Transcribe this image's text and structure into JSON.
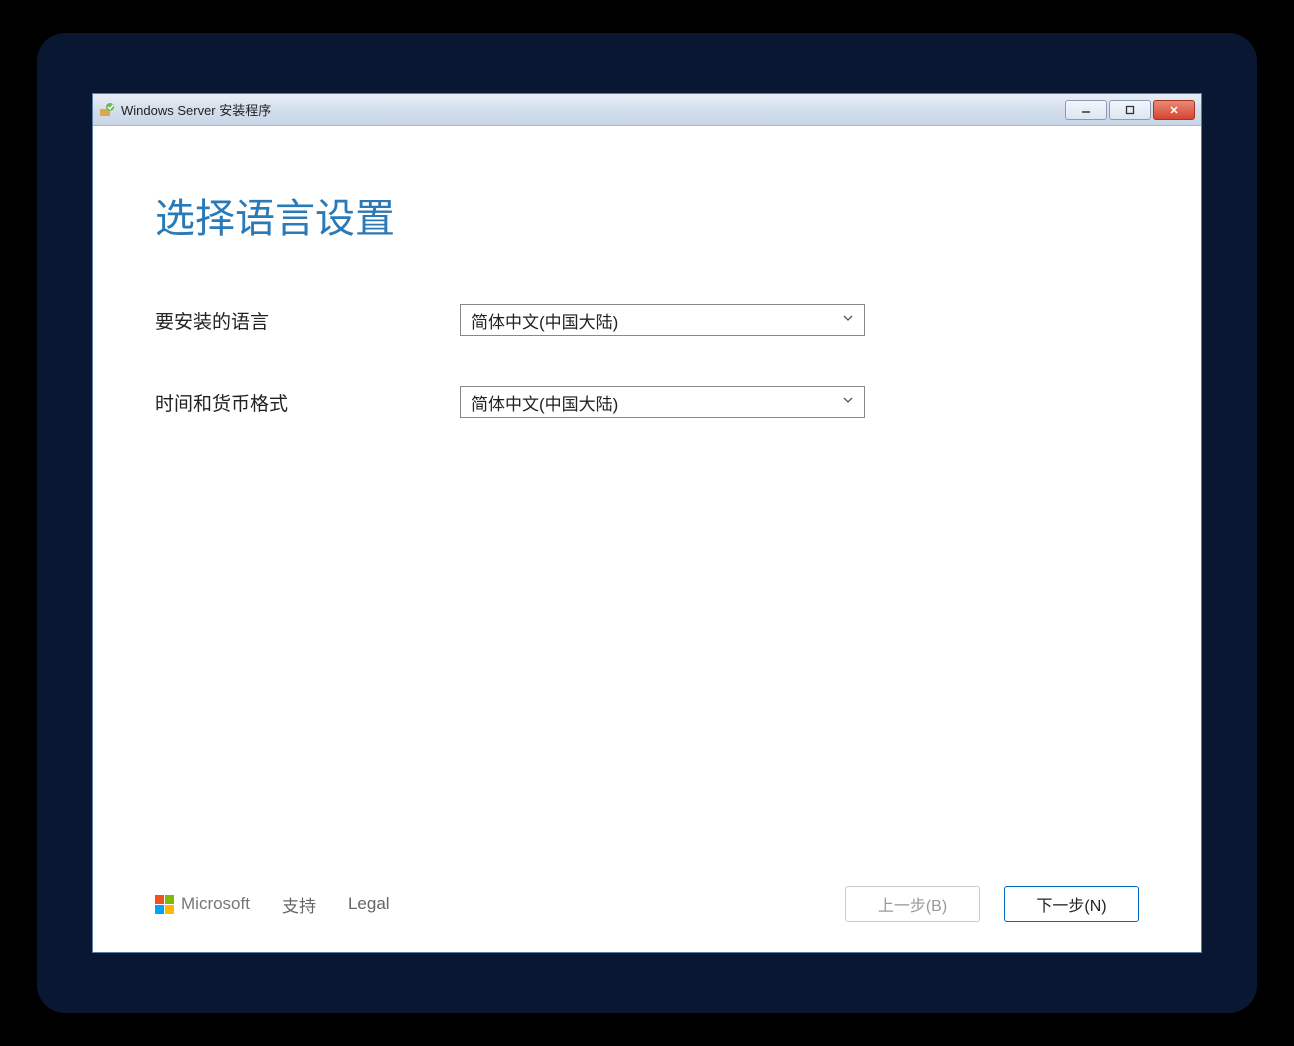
{
  "window": {
    "title": "Windows Server 安装程序"
  },
  "page": {
    "heading": "选择语言设置"
  },
  "form": {
    "language_label": "要安装的语言",
    "language_value": "简体中文(中国大陆)",
    "locale_label": "时间和货币格式",
    "locale_value": "简体中文(中国大陆)"
  },
  "footer": {
    "brand": "Microsoft",
    "support": "支持",
    "legal": "Legal",
    "back": "上一步(B)",
    "next": "下一步(N)"
  },
  "colors": {
    "ms_red": "#f25022",
    "ms_green": "#7fba00",
    "ms_blue": "#00a4ef",
    "ms_yellow": "#ffb900"
  }
}
